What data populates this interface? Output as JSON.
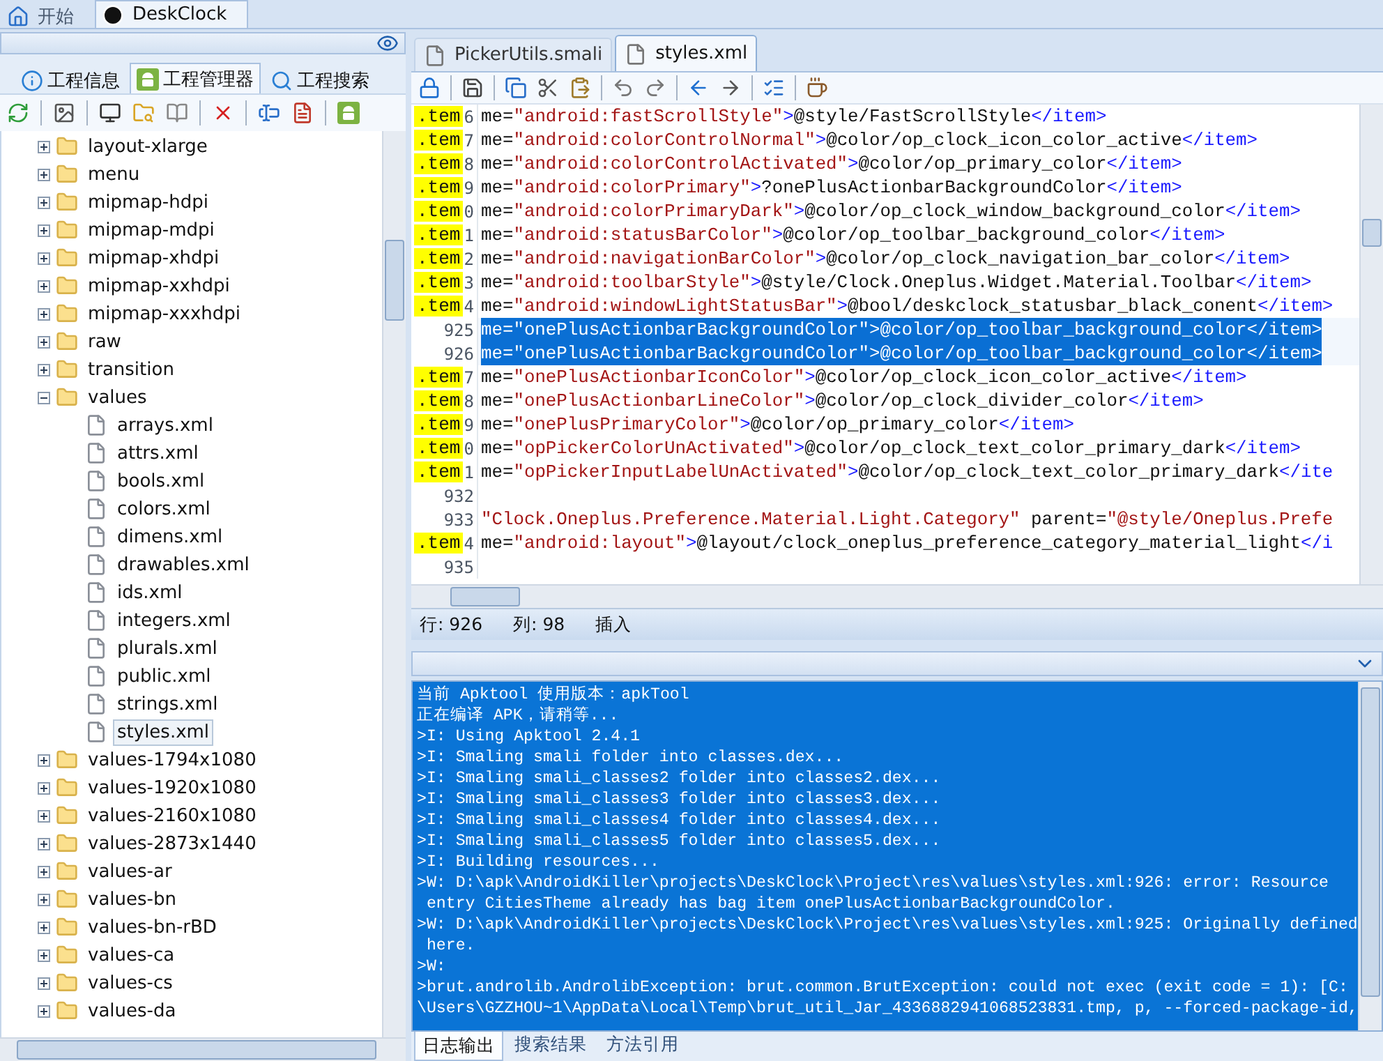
{
  "top_tabs": [
    {
      "label": "开始",
      "selected": false
    },
    {
      "label": "DeskClock",
      "selected": true
    }
  ],
  "project_tabs": [
    {
      "label": "工程信息",
      "selected": false
    },
    {
      "label": "工程管理器",
      "selected": true
    },
    {
      "label": "工程搜索",
      "selected": false
    }
  ],
  "tree": [
    {
      "label": "layout-xlarge",
      "kind": "folder",
      "expanded": false,
      "selected": false
    },
    {
      "label": "menu",
      "kind": "folder",
      "expanded": false,
      "selected": false
    },
    {
      "label": "mipmap-hdpi",
      "kind": "folder",
      "expanded": false,
      "selected": false
    },
    {
      "label": "mipmap-mdpi",
      "kind": "folder",
      "expanded": false,
      "selected": false
    },
    {
      "label": "mipmap-xhdpi",
      "kind": "folder",
      "expanded": false,
      "selected": false
    },
    {
      "label": "mipmap-xxhdpi",
      "kind": "folder",
      "expanded": false,
      "selected": false
    },
    {
      "label": "mipmap-xxxhdpi",
      "kind": "folder",
      "expanded": false,
      "selected": false
    },
    {
      "label": "raw",
      "kind": "folder",
      "expanded": false,
      "selected": false
    },
    {
      "label": "transition",
      "kind": "folder",
      "expanded": false,
      "selected": false
    },
    {
      "label": "values",
      "kind": "folder",
      "expanded": true,
      "selected": false,
      "children": [
        {
          "label": "arrays.xml",
          "kind": "file",
          "selected": false
        },
        {
          "label": "attrs.xml",
          "kind": "file",
          "selected": false
        },
        {
          "label": "bools.xml",
          "kind": "file",
          "selected": false
        },
        {
          "label": "colors.xml",
          "kind": "file",
          "selected": false
        },
        {
          "label": "dimens.xml",
          "kind": "file",
          "selected": false
        },
        {
          "label": "drawables.xml",
          "kind": "file",
          "selected": false
        },
        {
          "label": "ids.xml",
          "kind": "file",
          "selected": false
        },
        {
          "label": "integers.xml",
          "kind": "file",
          "selected": false
        },
        {
          "label": "plurals.xml",
          "kind": "file",
          "selected": false
        },
        {
          "label": "public.xml",
          "kind": "file",
          "selected": false
        },
        {
          "label": "strings.xml",
          "kind": "file",
          "selected": false
        },
        {
          "label": "styles.xml",
          "kind": "file",
          "selected": true
        }
      ]
    },
    {
      "label": "values-1794x1080",
      "kind": "folder",
      "expanded": false,
      "selected": false
    },
    {
      "label": "values-1920x1080",
      "kind": "folder",
      "expanded": false,
      "selected": false
    },
    {
      "label": "values-2160x1080",
      "kind": "folder",
      "expanded": false,
      "selected": false
    },
    {
      "label": "values-2873x1440",
      "kind": "folder",
      "expanded": false,
      "selected": false
    },
    {
      "label": "values-ar",
      "kind": "folder",
      "expanded": false,
      "selected": false
    },
    {
      "label": "values-bn",
      "kind": "folder",
      "expanded": false,
      "selected": false
    },
    {
      "label": "values-bn-rBD",
      "kind": "folder",
      "expanded": false,
      "selected": false
    },
    {
      "label": "values-ca",
      "kind": "folder",
      "expanded": false,
      "selected": false
    },
    {
      "label": "values-cs",
      "kind": "folder",
      "expanded": false,
      "selected": false
    },
    {
      "label": "values-da",
      "kind": "folder",
      "expanded": false,
      "selected": false
    }
  ],
  "editor_tabs": [
    {
      "label": "PickerUtils.smali",
      "selected": false
    },
    {
      "label": "styles.xml",
      "selected": true
    }
  ],
  "code": {
    "lines": [
      {
        "marker": ".tem",
        "number": "6",
        "selected": false,
        "parts": [
          {
            "kind": "plain",
            "text": "me="
          },
          {
            "kind": "string",
            "text": "\"android:fastScrollStyle\""
          },
          {
            "kind": "tag",
            "text": ">"
          },
          {
            "kind": "plain",
            "text": "@style/FastScrollStyle"
          },
          {
            "kind": "tag",
            "text": "</item>"
          }
        ]
      },
      {
        "marker": ".tem",
        "number": "7",
        "selected": false,
        "parts": [
          {
            "kind": "plain",
            "text": "me="
          },
          {
            "kind": "string",
            "text": "\"android:colorControlNormal\""
          },
          {
            "kind": "tag",
            "text": ">"
          },
          {
            "kind": "plain",
            "text": "@color/op_clock_icon_color_active"
          },
          {
            "kind": "tag",
            "text": "</item>"
          }
        ]
      },
      {
        "marker": ".tem",
        "number": "8",
        "selected": false,
        "parts": [
          {
            "kind": "plain",
            "text": "me="
          },
          {
            "kind": "string",
            "text": "\"android:colorControlActivated\""
          },
          {
            "kind": "tag",
            "text": ">"
          },
          {
            "kind": "plain",
            "text": "@color/op_primary_color"
          },
          {
            "kind": "tag",
            "text": "</item>"
          }
        ]
      },
      {
        "marker": ".tem",
        "number": "9",
        "selected": false,
        "parts": [
          {
            "kind": "plain",
            "text": "me="
          },
          {
            "kind": "string",
            "text": "\"android:colorPrimary\""
          },
          {
            "kind": "tag",
            "text": ">"
          },
          {
            "kind": "plain",
            "text": "?onePlusActionbarBackgroundColor"
          },
          {
            "kind": "tag",
            "text": "</item>"
          }
        ]
      },
      {
        "marker": ".tem",
        "number": "0",
        "selected": false,
        "parts": [
          {
            "kind": "plain",
            "text": "me="
          },
          {
            "kind": "string",
            "text": "\"android:colorPrimaryDark\""
          },
          {
            "kind": "tag",
            "text": ">"
          },
          {
            "kind": "plain",
            "text": "@color/op_clock_window_background_color"
          },
          {
            "kind": "tag",
            "text": "</item>"
          }
        ]
      },
      {
        "marker": ".tem",
        "number": "1",
        "selected": false,
        "parts": [
          {
            "kind": "plain",
            "text": "me="
          },
          {
            "kind": "string",
            "text": "\"android:statusBarColor\""
          },
          {
            "kind": "tag",
            "text": ">"
          },
          {
            "kind": "plain",
            "text": "@color/op_toolbar_background_color"
          },
          {
            "kind": "tag",
            "text": "</item>"
          }
        ]
      },
      {
        "marker": ".tem",
        "number": "2",
        "selected": false,
        "parts": [
          {
            "kind": "plain",
            "text": "me="
          },
          {
            "kind": "string",
            "text": "\"android:navigationBarColor\""
          },
          {
            "kind": "tag",
            "text": ">"
          },
          {
            "kind": "plain",
            "text": "@color/op_clock_navigation_bar_color"
          },
          {
            "kind": "tag",
            "text": "</item>"
          }
        ]
      },
      {
        "marker": ".tem",
        "number": "3",
        "selected": false,
        "parts": [
          {
            "kind": "plain",
            "text": "me="
          },
          {
            "kind": "string",
            "text": "\"android:toolbarStyle\""
          },
          {
            "kind": "tag",
            "text": ">"
          },
          {
            "kind": "plain",
            "text": "@style/Clock.Oneplus.Widget.Material.Toolbar"
          },
          {
            "kind": "tag",
            "text": "</item>"
          }
        ]
      },
      {
        "marker": ".tem",
        "number": "4",
        "selected": false,
        "parts": [
          {
            "kind": "plain",
            "text": "me="
          },
          {
            "kind": "string",
            "text": "\"android:windowLightStatusBar\""
          },
          {
            "kind": "tag",
            "text": ">"
          },
          {
            "kind": "plain",
            "text": "@bool/deskclock_statusbar_black_conent"
          },
          {
            "kind": "tag",
            "text": "</item>"
          }
        ]
      },
      {
        "number": "925",
        "selected": true,
        "text": "me=\"onePlusActionbarBackgroundColor\">@color/op_toolbar_background_color</item>"
      },
      {
        "number": "926",
        "selected": true,
        "text": "me=\"onePlusActionbarBackgroundColor\">@color/op_toolbar_background_color</item>"
      },
      {
        "marker": ".tem",
        "number": "7",
        "selected": false,
        "parts": [
          {
            "kind": "plain",
            "text": "me="
          },
          {
            "kind": "string",
            "text": "\"onePlusActionbarIconColor\""
          },
          {
            "kind": "tag",
            "text": ">"
          },
          {
            "kind": "plain",
            "text": "@color/op_clock_icon_color_active"
          },
          {
            "kind": "tag",
            "text": "</item>"
          }
        ]
      },
      {
        "marker": ".tem",
        "number": "8",
        "selected": false,
        "parts": [
          {
            "kind": "plain",
            "text": "me="
          },
          {
            "kind": "string",
            "text": "\"onePlusActionbarLineColor\""
          },
          {
            "kind": "tag",
            "text": ">"
          },
          {
            "kind": "plain",
            "text": "@color/op_clock_divider_color"
          },
          {
            "kind": "tag",
            "text": "</item>"
          }
        ]
      },
      {
        "marker": ".tem",
        "number": "9",
        "selected": false,
        "parts": [
          {
            "kind": "plain",
            "text": "me="
          },
          {
            "kind": "string",
            "text": "\"onePlusPrimaryColor\""
          },
          {
            "kind": "tag",
            "text": ">"
          },
          {
            "kind": "plain",
            "text": "@color/op_primary_color"
          },
          {
            "kind": "tag",
            "text": "</item>"
          }
        ]
      },
      {
        "marker": ".tem",
        "number": "0",
        "selected": false,
        "parts": [
          {
            "kind": "plain",
            "text": "me="
          },
          {
            "kind": "string",
            "text": "\"opPickerColorUnActivated\""
          },
          {
            "kind": "tag",
            "text": ">"
          },
          {
            "kind": "plain",
            "text": "@color/op_clock_text_color_primary_dark"
          },
          {
            "kind": "tag",
            "text": "</item>"
          }
        ]
      },
      {
        "marker": ".tem",
        "number": "1",
        "selected": false,
        "parts": [
          {
            "kind": "plain",
            "text": "me="
          },
          {
            "kind": "string",
            "text": "\"opPickerInputLabelUnActivated\""
          },
          {
            "kind": "tag",
            "text": ">"
          },
          {
            "kind": "plain",
            "text": "@color/op_clock_text_color_primary_dark"
          },
          {
            "kind": "tag",
            "text": "</ite"
          }
        ]
      },
      {
        "number": "932",
        "selected": false
      },
      {
        "number": "933",
        "selected": false,
        "parts": [
          {
            "kind": "string",
            "text": "\"Clock.Oneplus.Preference.Material.Light.Category\""
          },
          {
            "kind": "plain",
            "text": " parent="
          },
          {
            "kind": "string",
            "text": "\"@style/Oneplus.Prefe"
          }
        ]
      },
      {
        "marker": ".tem",
        "number": "4",
        "selected": false,
        "parts": [
          {
            "kind": "plain",
            "text": "me="
          },
          {
            "kind": "string",
            "text": "\"android:layout\""
          },
          {
            "kind": "tag",
            "text": ">"
          },
          {
            "kind": "plain",
            "text": "@layout/clock_oneplus_preference_category_material_light"
          },
          {
            "kind": "tag",
            "text": "</i"
          }
        ]
      },
      {
        "number": "935",
        "selected": false
      }
    ]
  },
  "status_bar": {
    "line": "行: 926",
    "column": "列: 98",
    "mode": "插入"
  },
  "log": [
    "当前 Apktool 使用版本：apkTool",
    "正在编译 APK，请稍等...",
    ">I: Using Apktool 2.4.1",
    ">I: Smaling smali folder into classes.dex...",
    ">I: Smaling smali_classes2 folder into classes2.dex...",
    ">I: Smaling smali_classes3 folder into classes3.dex...",
    ">I: Smaling smali_classes4 folder into classes4.dex...",
    ">I: Smaling smali_classes5 folder into classes5.dex...",
    ">I: Building resources...",
    ">W: D:\\apk\\AndroidKiller\\projects\\DeskClock\\Project\\res\\values\\styles.xml:926: error: Resource",
    " entry CitiesTheme already has bag item onePlusActionbarBackgroundColor.",
    ">W: D:\\apk\\AndroidKiller\\projects\\DeskClock\\Project\\res\\values\\styles.xml:925: Originally defined",
    " here.",
    ">W:",
    ">brut.androlib.AndrolibException: brut.common.BrutException: could not exec (exit code = 1): [C:",
    "\\Users\\GZZHOU~1\\AppData\\Local\\Temp\\brut_util_Jar_4336882941068523831.tmp, p, --forced-package-id,"
  ],
  "output_tabs": [
    {
      "label": "日志输出",
      "selected": true
    },
    {
      "label": "搜索结果",
      "selected": false
    },
    {
      "label": "方法引用",
      "selected": false
    }
  ]
}
